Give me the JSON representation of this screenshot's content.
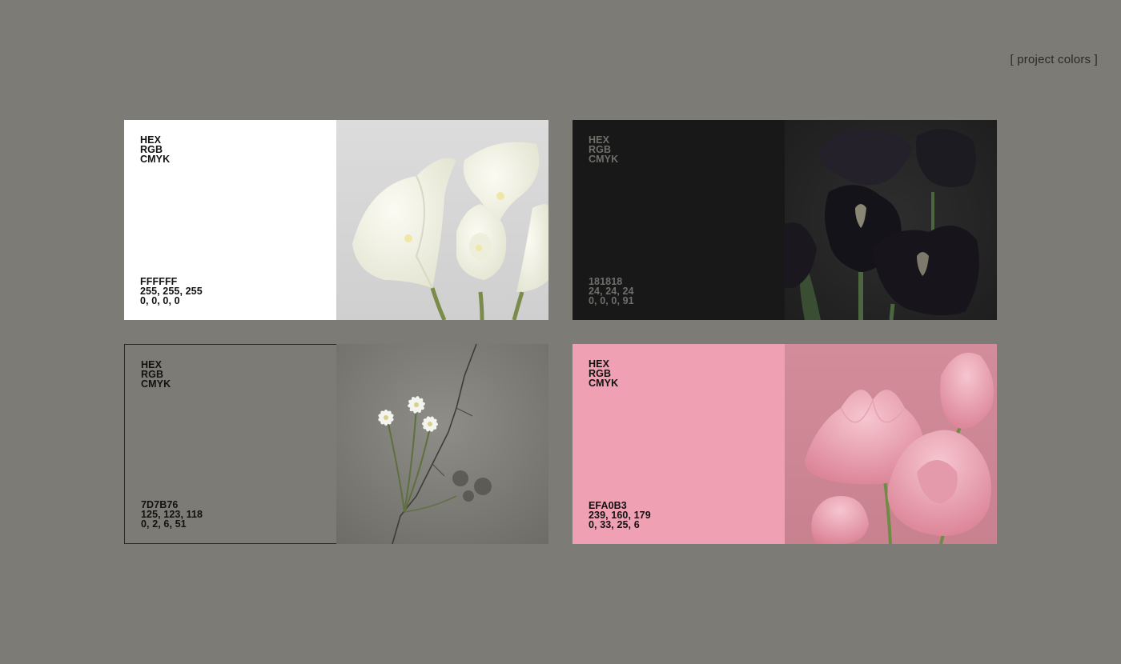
{
  "header": {
    "section_label": "[ project colors ]"
  },
  "colors": [
    {
      "name_labels": [
        "HEX",
        "RGB",
        "CMYK"
      ],
      "hex": "FFFFFF",
      "rgb": "255, 255, 255",
      "cmyk": "0, 0, 0, 0",
      "swatch_color": "#ffffff",
      "text_color": "#111111",
      "photo": "white-calla-lily"
    },
    {
      "name_labels": [
        "HEX",
        "RGB",
        "CMYK"
      ],
      "hex": "181818",
      "rgb": "24, 24, 24",
      "cmyk": "0, 0, 0, 91",
      "swatch_color": "#181818",
      "text_color": "#6f6e6b",
      "photo": "black-iris"
    },
    {
      "name_labels": [
        "HEX",
        "RGB",
        "CMYK"
      ],
      "hex": "7D7B76",
      "rgb": "125, 123, 118",
      "cmyk": "0, 2, 6, 51",
      "swatch_color": "#7d7b76",
      "text_color": "#111111",
      "photo": "white-flower-in-concrete-crack"
    },
    {
      "name_labels": [
        "HEX",
        "RGB",
        "CMYK"
      ],
      "hex": "EFA0B3",
      "rgb": "239, 160, 179",
      "cmyk": "0, 33, 25, 6",
      "swatch_color": "#efa0b3",
      "text_color": "#111111",
      "photo": "pink-lotus"
    }
  ]
}
